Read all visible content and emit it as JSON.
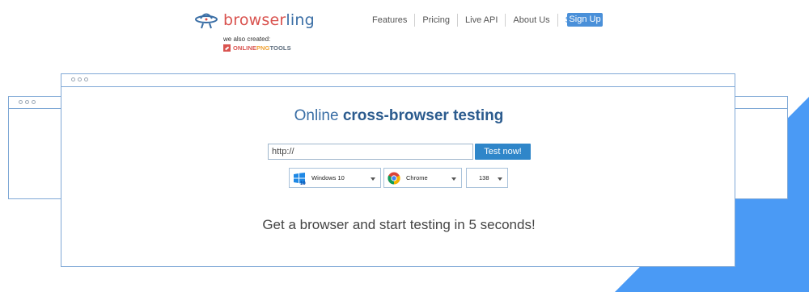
{
  "header": {
    "logo_part1": "browser",
    "logo_part2": "ling",
    "also_created": "we also created:",
    "partner_part1": "ONLINE",
    "partner_part2": "PNG",
    "partner_part3": "TOOLS",
    "nav": [
      "Features",
      "Pricing",
      "Live API",
      "About Us"
    ],
    "signin": "Sign In",
    "signup": "Sign Up"
  },
  "main": {
    "headline_light": "Online ",
    "headline_bold": "cross-browser testing",
    "url_value": "http://",
    "test_button": "Test now!",
    "os_select": "Windows 10",
    "browser_select": "Chrome",
    "version_select": "138",
    "tagline": "Get a browser and start testing in 5 seconds!"
  },
  "colors": {
    "accent_blue": "#4a90d9",
    "logo_red": "#d9534f",
    "logo_blue": "#3a6ea5",
    "button_blue": "#2f86c9"
  },
  "icons": {
    "logo": "ufo-icon",
    "os": "windows-icon",
    "browser": "chrome-icon",
    "partner": "hammer-icon"
  }
}
